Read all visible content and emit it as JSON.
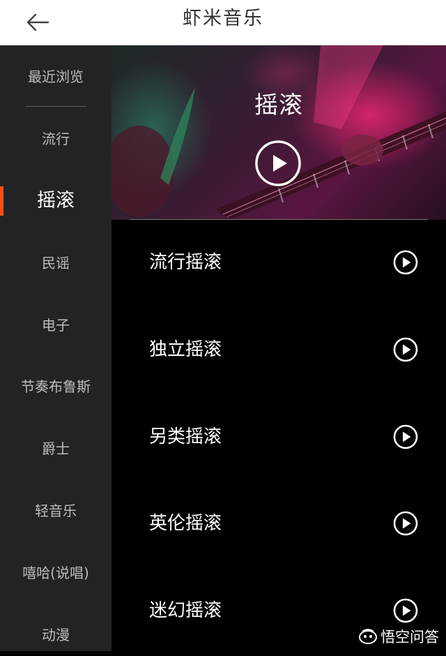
{
  "header": {
    "title": "虾米音乐",
    "back_icon": "back-arrow-icon"
  },
  "sidebar": {
    "items": [
      {
        "label": "最近浏览",
        "active": false
      },
      {
        "label": "流行",
        "active": false
      },
      {
        "label": "摇滚",
        "active": true
      },
      {
        "label": "民谣",
        "active": false
      },
      {
        "label": "电子",
        "active": false
      },
      {
        "label": "节奏布鲁斯",
        "active": false
      },
      {
        "label": "爵士",
        "active": false
      },
      {
        "label": "轻音乐",
        "active": false
      },
      {
        "label": "嘻哈(说唱)",
        "active": false
      },
      {
        "label": "动漫",
        "active": false
      }
    ]
  },
  "hero": {
    "title": "摇滚",
    "play_icon": "play-circle-icon"
  },
  "list": {
    "items": [
      {
        "label": "流行摇滚"
      },
      {
        "label": "独立摇滚"
      },
      {
        "label": "另类摇滚"
      },
      {
        "label": "英伦摇滚"
      },
      {
        "label": "迷幻摇滚"
      }
    ]
  },
  "watermark": {
    "text": "悟空问答",
    "icon": "wukong-logo-icon"
  },
  "colors": {
    "accent": "#ff4f14",
    "sidebar_bg": "#232323",
    "main_bg": "#000000",
    "topbar_bg": "#ffffff"
  }
}
